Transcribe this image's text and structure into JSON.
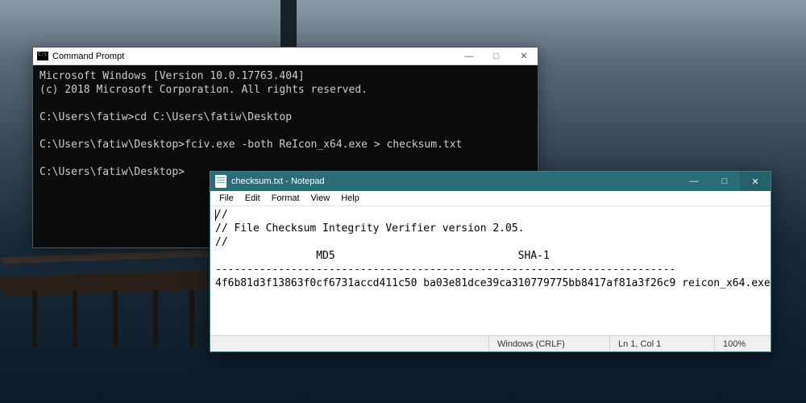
{
  "cmd": {
    "title": "Command Prompt",
    "lines": {
      "l0": "Microsoft Windows [Version 10.0.17763.404]",
      "l1": "(c) 2018 Microsoft Corporation. All rights reserved.",
      "l2": "",
      "l3": "C:\\Users\\fatiw>cd C:\\Users\\fatiw\\Desktop",
      "l4": "",
      "l5": "C:\\Users\\fatiw\\Desktop>fciv.exe -both ReIcon_x64.exe > checksum.txt",
      "l6": "",
      "l7": "C:\\Users\\fatiw\\Desktop>"
    },
    "ctrl": {
      "min": "—",
      "max": "□",
      "close": "✕"
    }
  },
  "notepad": {
    "title": "checksum.txt - Notepad",
    "menu": {
      "file": "File",
      "edit": "Edit",
      "format": "Format",
      "view": "View",
      "help": "Help"
    },
    "lines": {
      "l0": "//",
      "l1": "// File Checksum Integrity Verifier version 2.05.",
      "l2": "//",
      "l3": "                MD5                             SHA-1",
      "l4": "-------------------------------------------------------------------------",
      "l5": "4f6b81d3f13863f0cf6731accd411c50 ba03e81dce39ca310779775bb8417af81a3f26c9 reicon_x64.exe"
    },
    "status": {
      "encoding": "Windows (CRLF)",
      "pos": "Ln 1, Col 1",
      "zoom": "100%"
    },
    "ctrl": {
      "min": "—",
      "max": "□",
      "close": "✕"
    }
  }
}
